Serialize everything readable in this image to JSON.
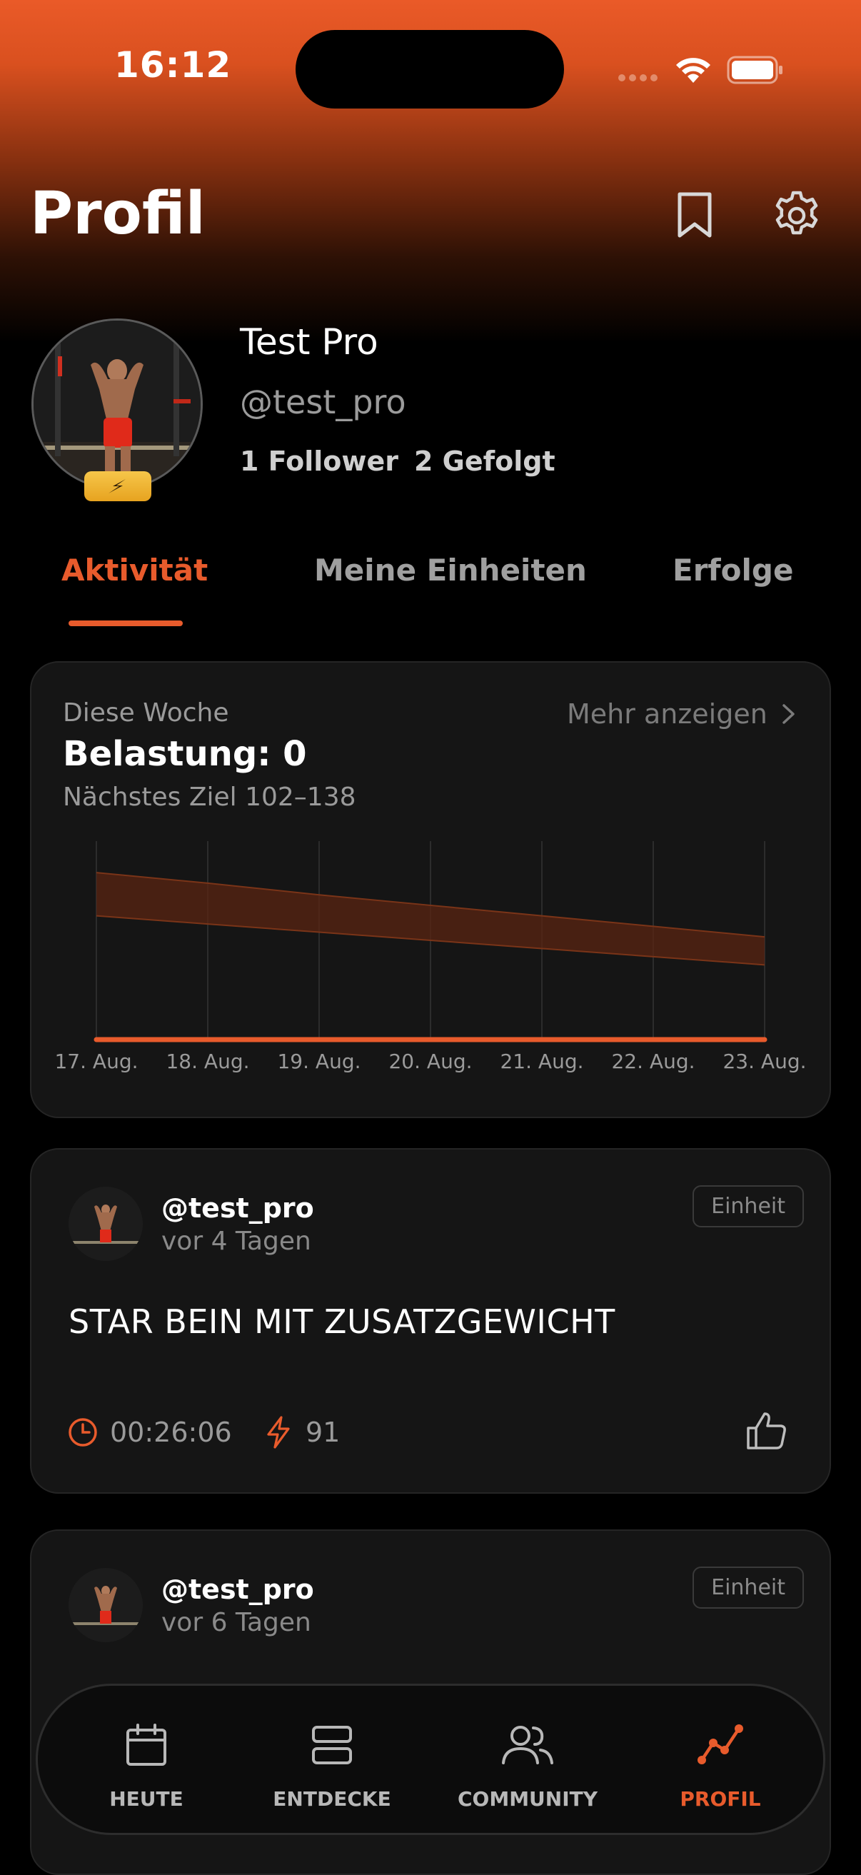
{
  "status_bar": {
    "time": "16:12"
  },
  "header": {
    "title": "Profil"
  },
  "profile": {
    "name": "Test Pro",
    "handle": "@test_pro",
    "followers": "1 Follower",
    "following": "2 Gefolgt"
  },
  "tabs": [
    {
      "label": "Aktivität",
      "active": true
    },
    {
      "label": "Meine Einheiten",
      "active": false
    },
    {
      "label": "Erfolge",
      "active": false
    }
  ],
  "load_card": {
    "period": "Diese Woche",
    "title": "Belastung: 0",
    "goal": "Nächstes Ziel 102–138",
    "more": "Mehr anzeigen"
  },
  "chart_data": {
    "type": "area",
    "x": [
      "17. Aug.",
      "18. Aug.",
      "19. Aug.",
      "20. Aug.",
      "21. Aug.",
      "22. Aug.",
      "23. Aug."
    ],
    "series": [
      {
        "values": [
          0,
          0,
          0,
          0,
          0,
          0,
          0
        ]
      }
    ],
    "target_band": {
      "upper": [
        143,
        134,
        124,
        115,
        106,
        97,
        88
      ],
      "lower": [
        106,
        99,
        92,
        85,
        78,
        71,
        64
      ]
    },
    "ylim": [
      0,
      170
    ],
    "grid": "vertical",
    "colors": {
      "line": "#e85b2c",
      "band": "#5a2412"
    }
  },
  "posts": [
    {
      "handle": "@test_pro",
      "time": "vor 4 Tagen",
      "chip": "Einheit",
      "title": "STAR BEIN MIT ZUSATZGEWICHT",
      "duration": "00:26:06",
      "load": "91"
    },
    {
      "handle": "@test_pro",
      "time": "vor 6 Tagen",
      "chip": "Einheit"
    }
  ],
  "nav": [
    {
      "label": "HEUTE",
      "icon": "calendar-icon",
      "active": false
    },
    {
      "label": "ENTDECKE",
      "icon": "layers-icon",
      "active": false
    },
    {
      "label": "COMMUNITY",
      "icon": "people-icon",
      "active": false
    },
    {
      "label": "PROFIL",
      "icon": "activity-graph-icon",
      "active": true
    }
  ],
  "colors": {
    "accent": "#e85b2c",
    "background": "#000000",
    "card": "#151515"
  }
}
